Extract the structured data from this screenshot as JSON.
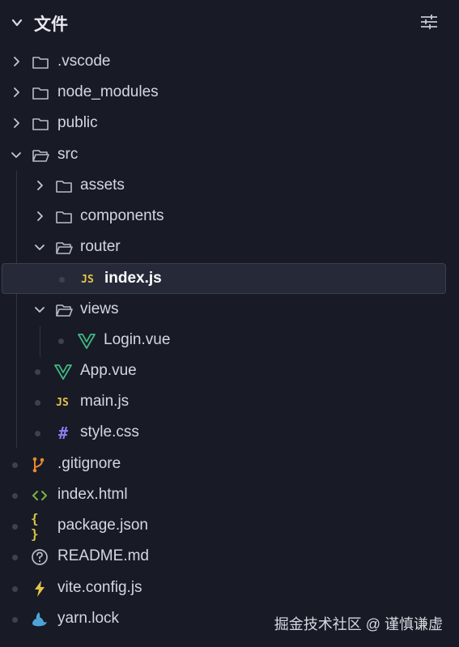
{
  "header": {
    "title": "文件"
  },
  "tree": {
    "vscode": ".vscode",
    "node_modules": "node_modules",
    "public": "public",
    "src": "src",
    "assets": "assets",
    "components": "components",
    "router": "router",
    "index_js": "index.js",
    "views": "views",
    "login_vue": "Login.vue",
    "app_vue": "App.vue",
    "main_js": "main.js",
    "style_css": "style.css",
    "gitignore": ".gitignore",
    "index_html": "index.html",
    "package_json": "package.json",
    "readme": "README.md",
    "vite_config": "vite.config.js",
    "yarn_lock": "yarn.lock"
  },
  "icons": {
    "js_badge": "JS",
    "css_badge": "#",
    "json_badge": "{ }"
  },
  "watermark": "掘金技术社区 @ 谨慎谦虚",
  "colors": {
    "background": "#181a25",
    "selected": "#262a38",
    "js": "#e6c34a",
    "vue": "#41b883",
    "css": "#8a7cf0",
    "git": "#e7892f",
    "html": "#7cb342",
    "vite": "#e6c34a",
    "yarn": "#4da3d9"
  }
}
